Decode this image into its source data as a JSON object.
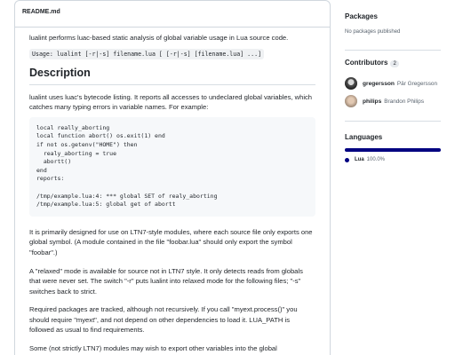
{
  "readme": {
    "filename": "README.md",
    "intro": "lualint performs luac-based static analysis of global variable usage in Lua source code.",
    "usage": "Usage: lualint [-r|-s] filename.lua [ [-r|-s] [filename.lua] ...]",
    "heading": "Description",
    "description": "lualint uses luac's bytecode listing. It reports all accesses to undeclared global variables, which catches many typing errors in variable names. For example:",
    "code_block": "local really_aborting\nlocal function abort() os.exit(1) end\nif not os.getenv(\"HOME\") then\n  realy_aborting = true\n  abortt()\nend\nreports:\n\n/tmp/example.lua:4: *** global SET of realy_aborting\n/tmp/example.lua:5: global get of abortt",
    "paragraphs": [
      "It is primarily designed for use on LTN7-style modules, where each source file only exports one global symbol. (A module contained in the file \"foobar.lua\" should only export the symbol \"foobar\".)",
      "A \"relaxed\" mode is available for source not in LTN7 style. It only detects reads from globals that were never set. The switch \"-r\" puts lualint into relaxed mode for the following files; \"-s\" switches back to strict.",
      "Required packages are tracked, although not recursively. If you call \"myext.process()\" you should require \"myext\", and not depend on other dependencies to load it. LUA_PATH is followed as usual to find requirements.",
      "Some (not strictly LTN7) modules may wish to export other variables into the global"
    ]
  },
  "sidebar": {
    "packages": {
      "title": "Packages",
      "note": "No packages published"
    },
    "contributors": {
      "title": "Contributors",
      "count": "2",
      "people": [
        {
          "login": "gregersson",
          "name": "Pär Gregersson"
        },
        {
          "login": "philips",
          "name": "Brandon Philips"
        }
      ]
    },
    "languages": {
      "title": "Languages",
      "items": [
        {
          "name": "Lua",
          "percent": "100.0%",
          "color": "#000080"
        }
      ]
    }
  }
}
